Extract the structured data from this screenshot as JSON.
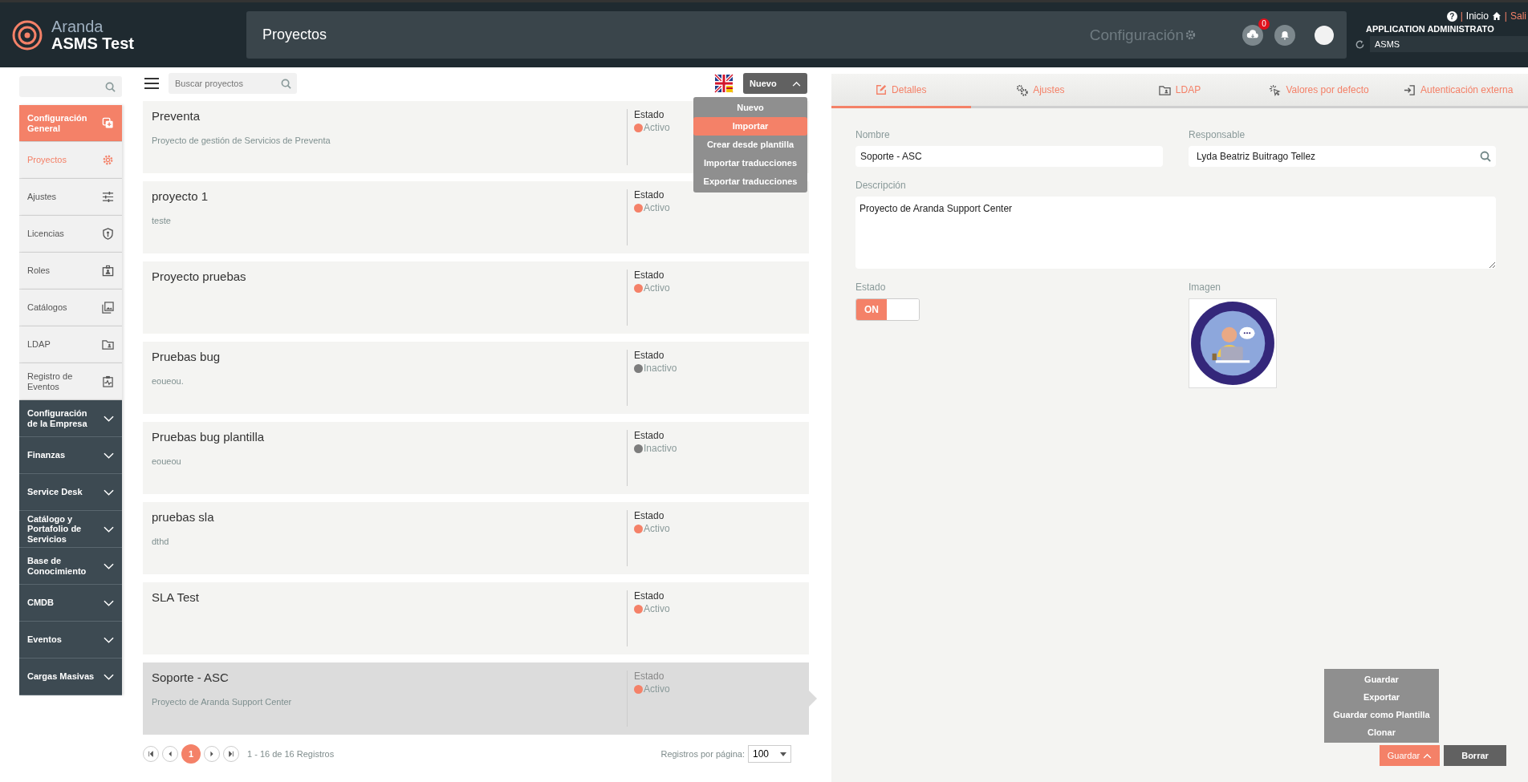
{
  "header": {
    "brand_top": "Aranda",
    "brand_bottom": "ASMS Test",
    "page_title": "Proyectos",
    "config_label": "Configuración",
    "notification_count": "0",
    "help": "?",
    "separators": [
      "|",
      "|"
    ],
    "links": [
      "Inicio",
      "Sali"
    ],
    "user_name": "APPLICATION ADMINISTRATO",
    "company": "ASMS"
  },
  "sidebar": {
    "sections": [
      {
        "label": "Configuración General",
        "kind": "open",
        "children": [
          {
            "label": "Proyectos",
            "selected": true
          },
          {
            "label": "Ajustes",
            "selected": false
          },
          {
            "label": "Licencias",
            "selected": false
          },
          {
            "label": "Roles",
            "selected": false
          },
          {
            "label": "Catálogos",
            "selected": false
          },
          {
            "label": "LDAP",
            "selected": false
          },
          {
            "label": "Registro de Eventos",
            "selected": false
          }
        ]
      },
      {
        "label": "Configuración de la Empresa",
        "kind": "closed"
      },
      {
        "label": "Finanzas",
        "kind": "closed"
      },
      {
        "label": "Service Desk",
        "kind": "closed"
      },
      {
        "label": "Catálogo y Portafolio de Servicios",
        "kind": "closed"
      },
      {
        "label": "Base de Conocimiento",
        "kind": "closed"
      },
      {
        "label": "CMDB",
        "kind": "closed"
      },
      {
        "label": "Eventos",
        "kind": "closed"
      },
      {
        "label": "Cargas Masivas",
        "kind": "closed"
      }
    ]
  },
  "toolbar": {
    "search_placeholder": "Buscar proyectos",
    "new_button": "Nuevo",
    "new_menu": [
      {
        "label": "Nuevo",
        "selected": false
      },
      {
        "label": "Importar",
        "selected": true
      },
      {
        "label": "Crear desde plantilla",
        "selected": false
      },
      {
        "label": "Importar traducciones",
        "selected": false
      },
      {
        "label": "Exportar traducciones",
        "selected": false
      }
    ]
  },
  "projects": [
    {
      "name": "Preventa",
      "description": "Proyecto de gestión de Servicios de Preventa",
      "status_label": "Estado",
      "status": "Activo",
      "active": true,
      "selected": false
    },
    {
      "name": "proyecto 1",
      "description": "teste",
      "status_label": "Estado",
      "status": "Activo",
      "active": true,
      "selected": false
    },
    {
      "name": "Proyecto pruebas",
      "status_label": "Estado",
      "status": "Activo",
      "active": true,
      "selected": false
    },
    {
      "name": "Pruebas bug",
      "description": "eoueou.",
      "status_label": "Estado",
      "status": "Inactivo",
      "active": false,
      "selected": false
    },
    {
      "name": "Pruebas bug plantilla",
      "description": "eoueou",
      "status_label": "Estado",
      "status": "Inactivo",
      "active": false,
      "selected": false
    },
    {
      "name": "pruebas sla",
      "description": "dthd",
      "status_label": "Estado",
      "status": "Activo",
      "active": true,
      "selected": false
    },
    {
      "name": "SLA Test",
      "status_label": "Estado",
      "status": "Activo",
      "active": true,
      "selected": false
    },
    {
      "name": "Soporte - ASC",
      "description": "Proyecto de Aranda Support Center",
      "status_label": "Estado",
      "status": "Activo",
      "active": true,
      "selected": true
    }
  ],
  "pagination": {
    "page": "1",
    "range": "1 - 16 de 16 Registros",
    "per_page_label": "Registros por página:",
    "per_page": "100"
  },
  "detail": {
    "tabs": [
      {
        "label": "Detalles",
        "selected": true
      },
      {
        "label": "Ajustes",
        "selected": false
      },
      {
        "label": "LDAP",
        "selected": false
      },
      {
        "label": "Valores por defecto",
        "selected": false
      },
      {
        "label": "Autenticación externa",
        "selected": false
      }
    ],
    "name_label": "Nombre",
    "name": "Soporte - ASC",
    "owner_label": "Responsable",
    "owner": "Lyda Beatriz Buitrago Tellez",
    "description_label": "Descripción",
    "description": "Proyecto de Aranda Support Center",
    "status_label": "Estado",
    "status_on": true,
    "status_text": "ON",
    "image_label": "Imagen"
  },
  "actions": {
    "save_menu": [
      "Guardar",
      "Exportar",
      "Guardar como Plantilla",
      "Clonar"
    ],
    "save_button": "Guardar",
    "delete_button": "Borrar"
  }
}
